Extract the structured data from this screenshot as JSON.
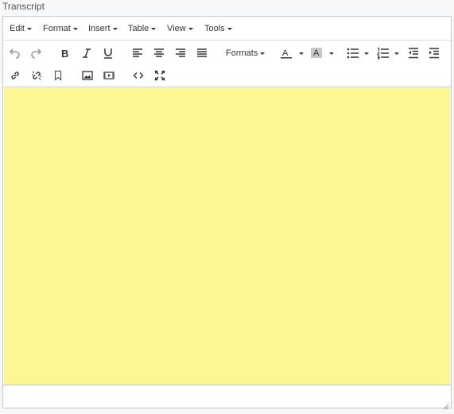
{
  "field": {
    "label": "Transcript"
  },
  "menubar": {
    "items": [
      {
        "label": "Edit"
      },
      {
        "label": "Format"
      },
      {
        "label": "Insert"
      },
      {
        "label": "Table"
      },
      {
        "label": "View"
      },
      {
        "label": "Tools"
      }
    ]
  },
  "toolbar": {
    "formats_label": "Formats",
    "text_color_glyph": "A",
    "background_color_glyph": "A",
    "colors": {
      "icon": "#333333",
      "icon_disabled": "#9a9a9a",
      "text_color_underline": "#333333",
      "background_color_fill": "#c8c8c8"
    }
  },
  "content": {
    "background_color": "#fcf792",
    "text": ""
  }
}
